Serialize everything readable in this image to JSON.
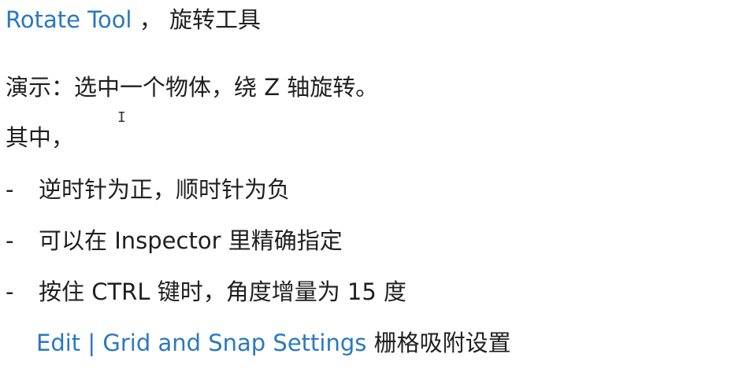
{
  "heading": {
    "tool_name": "Rotate Tool",
    "separator": " ， ",
    "subtitle": "旋转工具"
  },
  "lines": {
    "demo": "演示：选中一个物体，绕 Z 轴旋转。",
    "among": "其中，"
  },
  "bullets": {
    "marker": "-",
    "items": [
      "逆时针为正，顺时针为负",
      "可以在 Inspector 里精确指定",
      "按住 CTRL 键时，角度增量为 15 度"
    ]
  },
  "menu": {
    "path": "Edit | Grid and Snap Settings",
    "description": " 栅格吸附设置"
  },
  "cursor_glyph": "I"
}
